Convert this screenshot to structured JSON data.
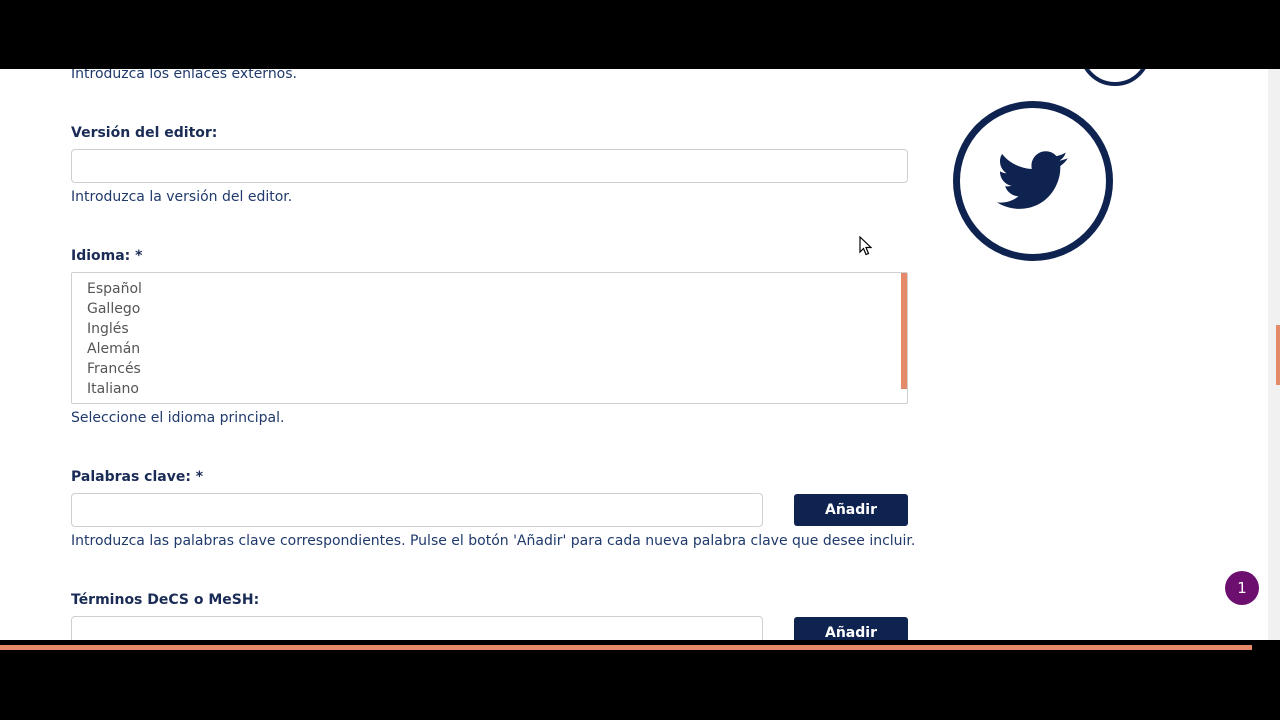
{
  "form": {
    "externos_help": "Introduzca los enlaces externos.",
    "version_label": "Versión del editor:",
    "version_value": "",
    "version_help": "Introduzca la versión del editor.",
    "idioma_label": "Idioma: *",
    "idioma_options": [
      "Español",
      "Gallego",
      "Inglés",
      "Alemán",
      "Francés",
      "Italiano"
    ],
    "idioma_help": "Seleccione el idioma principal.",
    "palabras_label": "Palabras clave: *",
    "palabras_value": "",
    "palabras_button": "Añadir",
    "palabras_help": "Introduzca las palabras clave correspondientes. Pulse el botón 'Añadir' para cada nueva palabra clave que desee incluir.",
    "decs_label": "Términos DeCS o MeSH:",
    "decs_value": "",
    "decs_button": "Añadir"
  },
  "icons": {
    "social": "twitter-icon",
    "social_top": "social-circle-icon"
  },
  "badge": {
    "count": "1"
  },
  "colors": {
    "navy": "#0f2350",
    "accent": "#e58a69",
    "badge": "#6d0f6f",
    "help_text": "#1f3a6b"
  }
}
